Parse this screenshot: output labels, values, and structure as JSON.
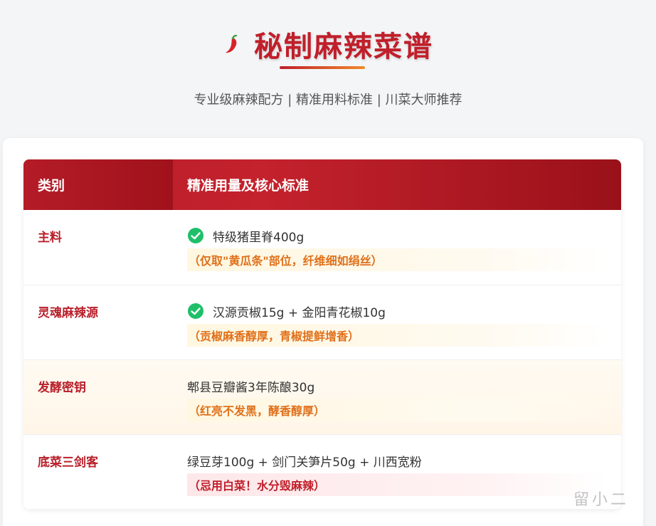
{
  "header": {
    "title": "秘制麻辣菜谱",
    "title_icon": "chili-pepper-icon",
    "subtitle": "专业级麻辣配方 | 精准用料标准 | 川菜大师推荐"
  },
  "table": {
    "columns": [
      "类别",
      "精准用量及核心标准"
    ],
    "rows": [
      {
        "category": "主料",
        "content": "特级猪里脊400g",
        "note": "（仅取\"黄瓜条\"部位，纤维细如绢丝）",
        "check": true
      },
      {
        "category": "灵魂麻辣源",
        "content": "汉源贡椒15g + 金阳青花椒10g",
        "note": "（贡椒麻香醇厚，青椒提鲜增香）",
        "check": true
      },
      {
        "category": "发酵密钥",
        "content": "郫县豆瓣酱3年陈酿30g",
        "note": "（红亮不发黑，酵香醇厚）",
        "check": false
      },
      {
        "category": "底菜三剑客",
        "content": "绿豆芽100g + 剑门关笋片50g + 川西宽粉",
        "note": "（忌用白菜！水分毁麻辣）",
        "check": false
      }
    ]
  },
  "colors": {
    "accent": "#c01f2a",
    "note_orange": "#e0701a",
    "check_green": "#1fbf6a"
  },
  "watermark": "留小二"
}
